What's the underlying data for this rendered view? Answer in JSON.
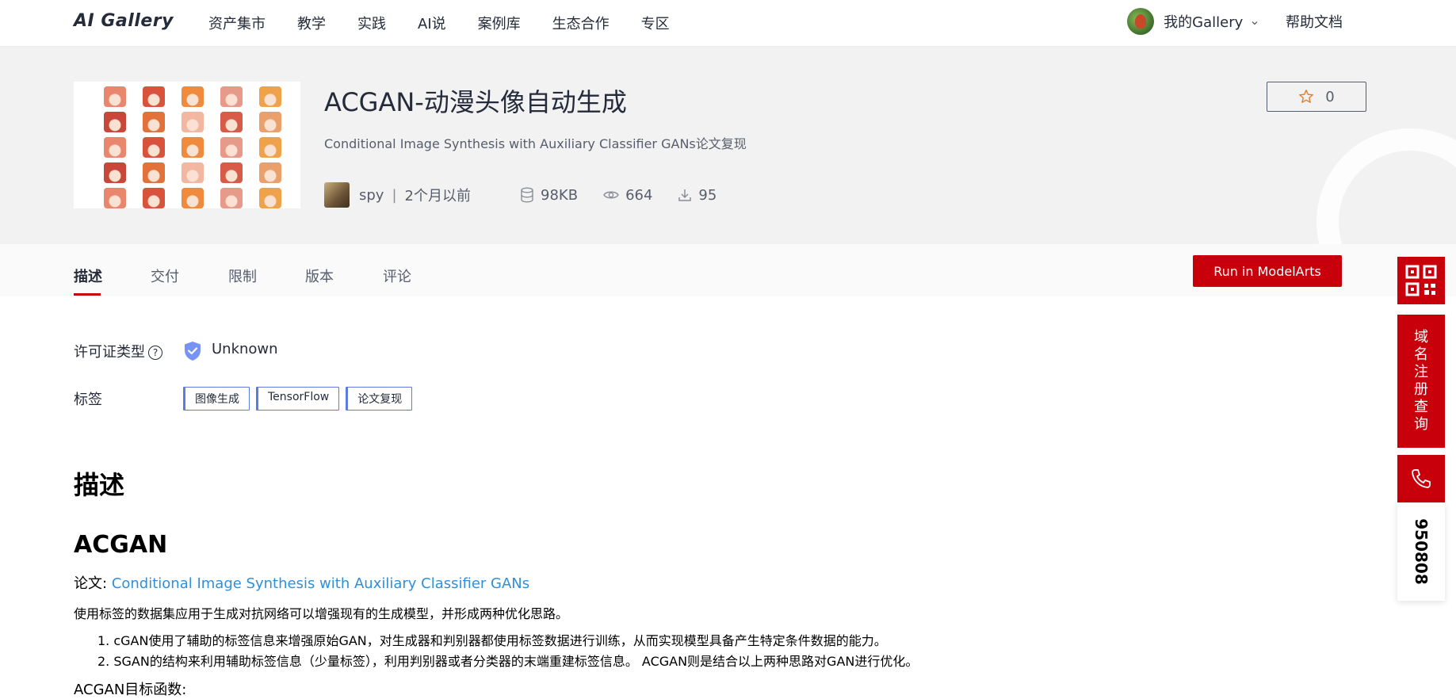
{
  "topbar": {
    "logo": "AI Gallery",
    "nav": [
      "资产集市",
      "教学",
      "实践",
      "AI说",
      "案例库",
      "生态合作",
      "专区"
    ],
    "my_gallery": "我的Gallery",
    "help": "帮助文档"
  },
  "asset": {
    "title": "ACGAN-动漫头像自动生成",
    "subtitle": "Conditional Image Synthesis with Auxiliary Classifier GANs论文复现",
    "author": "spy",
    "time": "2个月以前",
    "size": "98KB",
    "views": "664",
    "downloads": "95",
    "stars": "0"
  },
  "tabs": [
    "描述",
    "交付",
    "限制",
    "版本",
    "评论"
  ],
  "run_button": "Run in ModelArts",
  "info": {
    "license_label": "许可证类型",
    "license_value": "Unknown",
    "tags_label": "标签",
    "tags": [
      "图像生成",
      "TensorFlow",
      "论文复现"
    ]
  },
  "body": {
    "desc_heading": "描述",
    "acgan_heading": "ACGAN",
    "paper_label": "论文:",
    "paper_link": "Conditional Image Synthesis with Auxiliary Classifier GANs",
    "para1": "使用标签的数据集应用于生成对抗网络可以增强现有的生成模型，并形成两种优化思路。",
    "list": [
      "1. cGAN使用了辅助的标签信息来增强原始GAN，对生成器和判别器都使用标签数据进行训练，从而实现模型具备产生特定条件数据的能力。",
      "2. SGAN的结构来利用辅助标签信息（少量标签），利用判别器或者分类器的末端重建标签信息。 ACGAN则是结合以上两种思路对GAN进行优化。"
    ],
    "objective": "ACGAN目标函数:"
  },
  "side": {
    "domain_chars": [
      "域",
      "名",
      "注",
      "册",
      "查",
      "询"
    ],
    "phone": "950808"
  },
  "colors": {
    "brand_red": "#c7000b",
    "link_blue": "#2f8fd8",
    "tag_border": "#5e7ce0"
  }
}
